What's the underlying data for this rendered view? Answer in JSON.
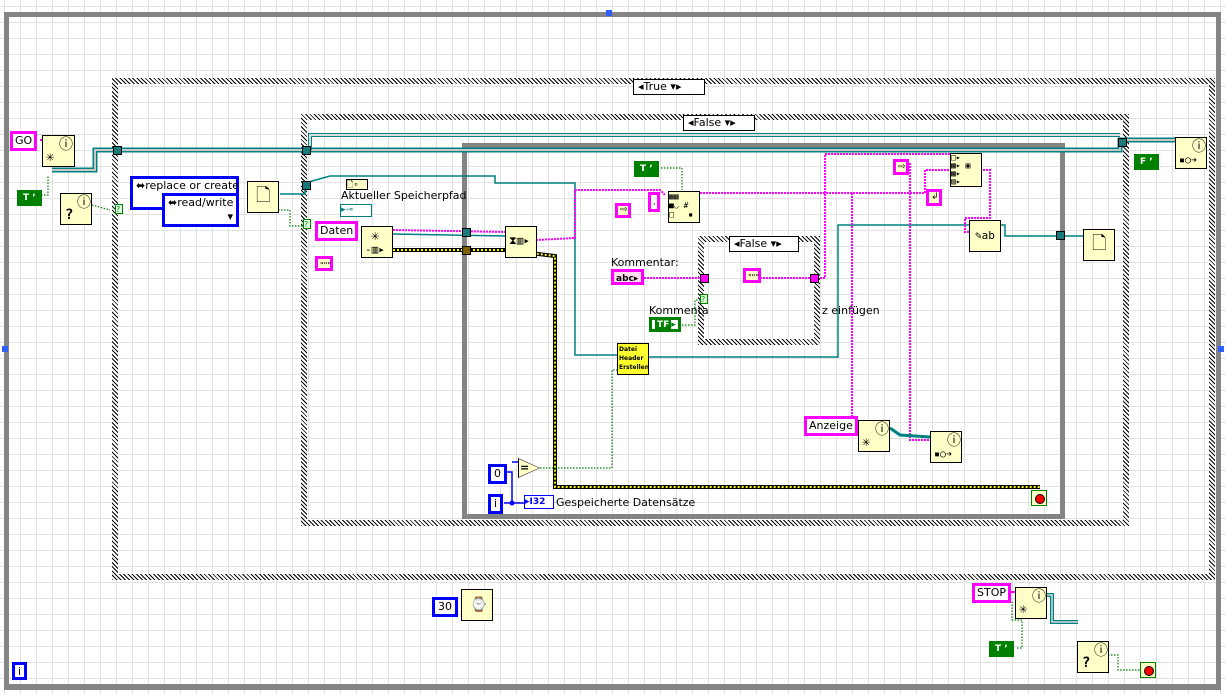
{
  "colors": {
    "string_wire": "#ff00ff",
    "refnum_wire": "#008080",
    "bool_wire": "#008000",
    "int_wire": "#0000ff",
    "node_fill": "#ffffc8",
    "loop_border": "#848484"
  },
  "outer_case": {
    "selector": "True"
  },
  "inner_case": {
    "selector": "False"
  },
  "nested_case": {
    "selector": "False"
  },
  "constants": {
    "go": "GO",
    "stop": "STOP",
    "daten": "Daten",
    "anzeige": "Anzeige",
    "open_mode": "replace or create",
    "access": "read/write",
    "true_const": "T",
    "false_const": "F",
    "zero": "0",
    "wait_ms": "30",
    "abc": "abc",
    "tf": "TF",
    "i32": "I32",
    "iteration": "i",
    "info": "i"
  },
  "labels": {
    "speicherpfad": "Aktueller Speicherpfad",
    "kommentar": "Kommentar:",
    "kommentar_bool_a": "Kommenta",
    "kommentar_bool_b": "z einfügen",
    "gespeichert": "Gespeicherte Datensätze"
  },
  "subvi": {
    "line1": "Datei",
    "line2": "Header",
    "line3": "Erstellen"
  },
  "icons": [
    "notifier-create-icon",
    "notifier-status-icon",
    "open-file-icon",
    "queue-create-icon",
    "dequeue-icon",
    "string-format-icon",
    "build-array-icon",
    "write-file-icon",
    "close-file-icon",
    "send-notification-icon",
    "wait-ms-icon",
    "stop-terminal-icon",
    "equal-icon"
  ]
}
